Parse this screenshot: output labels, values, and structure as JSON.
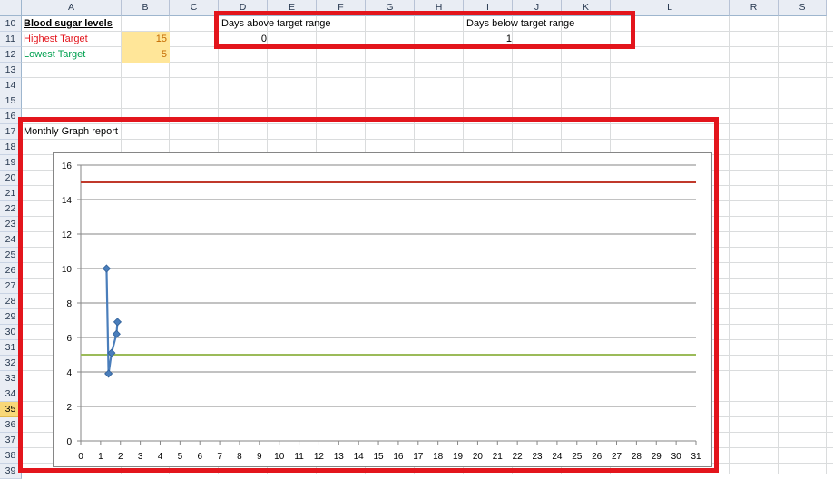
{
  "columns": [
    "A",
    "B",
    "C",
    "D",
    "E",
    "F",
    "G",
    "H",
    "I",
    "J",
    "K",
    "L",
    "R",
    "S"
  ],
  "rows": [
    "10",
    "11",
    "12",
    "13",
    "14",
    "15",
    "16",
    "17",
    "18",
    "19",
    "20",
    "21",
    "22",
    "23",
    "24",
    "25",
    "26",
    "27",
    "28",
    "29",
    "30",
    "31",
    "32",
    "33",
    "34",
    "35",
    "36",
    "37",
    "38",
    "39"
  ],
  "selected_row": "35",
  "sheet": {
    "title": "Blood sugar levels",
    "highest_label": "Highest Target",
    "highest_value": "15",
    "lowest_label": "Lowest Target",
    "lowest_value": "5",
    "above_label": "Days above target range",
    "above_value": "0",
    "below_label": "Days below target range",
    "below_value": "1",
    "report_title": "Monthly Graph report"
  },
  "colors": {
    "highest": "#e3151c",
    "lowest": "#00a050",
    "target_fill": "#ffe699",
    "highlight_box": "#e3151c",
    "series": "#4a7ebb",
    "upper_line": "#c0392b",
    "lower_line": "#9bbb59"
  },
  "chart_data": {
    "type": "line",
    "xlim": [
      0,
      31
    ],
    "ylim": [
      0,
      16
    ],
    "x_ticks": [
      0,
      1,
      2,
      3,
      4,
      5,
      6,
      7,
      8,
      9,
      10,
      11,
      12,
      13,
      14,
      15,
      16,
      17,
      18,
      19,
      20,
      21,
      22,
      23,
      24,
      25,
      26,
      27,
      28,
      29,
      30,
      31
    ],
    "y_ticks": [
      0,
      2,
      4,
      6,
      8,
      10,
      12,
      14,
      16
    ],
    "grid": true,
    "series": [
      {
        "values": [
          [
            1.3,
            10
          ],
          [
            1.4,
            3.9
          ],
          [
            1.55,
            5.1
          ],
          [
            1.8,
            6.2
          ],
          [
            1.85,
            6.9
          ]
        ]
      },
      {
        "values": [
          [
            0,
            15
          ],
          [
            31,
            15
          ]
        ]
      },
      {
        "values": [
          [
            0,
            5
          ],
          [
            31,
            5
          ]
        ]
      }
    ]
  }
}
